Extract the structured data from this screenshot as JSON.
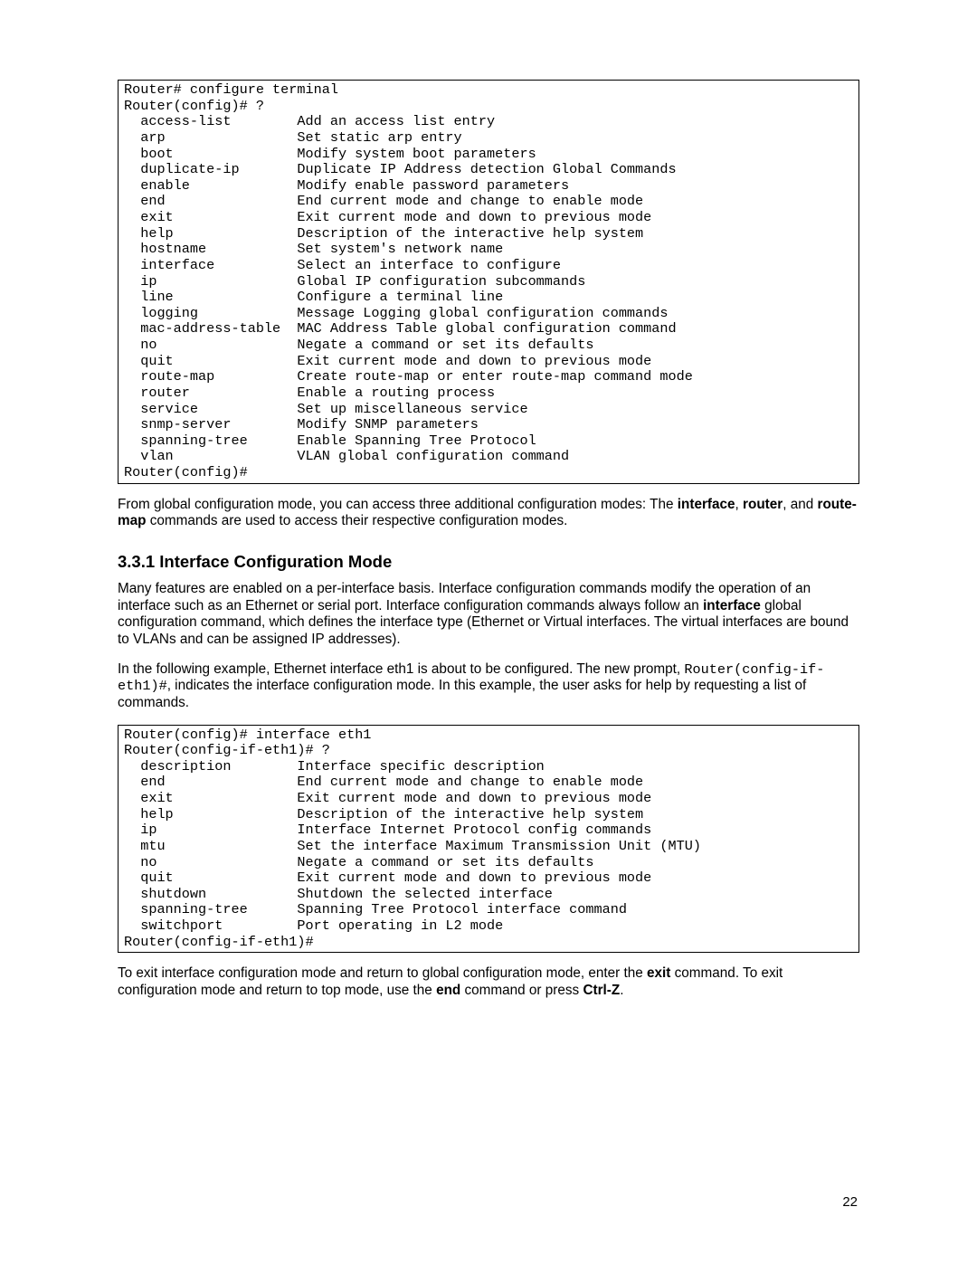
{
  "cli1": {
    "lines_top": [
      "Router# configure terminal",
      "Router(config)# ?"
    ],
    "items": [
      {
        "cmd": "access-list",
        "desc": "Add an access list entry"
      },
      {
        "cmd": "arp",
        "desc": "Set static arp entry"
      },
      {
        "cmd": "boot",
        "desc": "Modify system boot parameters"
      },
      {
        "cmd": "duplicate-ip",
        "desc": "Duplicate IP Address detection Global Commands"
      },
      {
        "cmd": "enable",
        "desc": "Modify enable password parameters"
      },
      {
        "cmd": "end",
        "desc": "End current mode and change to enable mode"
      },
      {
        "cmd": "exit",
        "desc": "Exit current mode and down to previous mode"
      },
      {
        "cmd": "help",
        "desc": "Description of the interactive help system"
      },
      {
        "cmd": "hostname",
        "desc": "Set system's network name"
      },
      {
        "cmd": "interface",
        "desc": "Select an interface to configure"
      },
      {
        "cmd": "ip",
        "desc": "Global IP configuration subcommands"
      },
      {
        "cmd": "line",
        "desc": "Configure a terminal line"
      },
      {
        "cmd": "logging",
        "desc": "Message Logging global configuration commands"
      },
      {
        "cmd": "mac-address-table",
        "desc": "MAC Address Table global configuration command"
      },
      {
        "cmd": "no",
        "desc": "Negate a command or set its defaults"
      },
      {
        "cmd": "quit",
        "desc": "Exit current mode and down to previous mode"
      },
      {
        "cmd": "route-map",
        "desc": "Create route-map or enter route-map command mode"
      },
      {
        "cmd": "router",
        "desc": "Enable a routing process"
      },
      {
        "cmd": "service",
        "desc": "Set up miscellaneous service"
      },
      {
        "cmd": "snmp-server",
        "desc": "Modify SNMP parameters"
      },
      {
        "cmd": "spanning-tree",
        "desc": "Enable Spanning Tree Protocol"
      },
      {
        "cmd": "vlan",
        "desc": "VLAN global configuration command"
      }
    ],
    "lines_bottom": [
      "Router(config)#"
    ]
  },
  "para1": {
    "pre1": "From global configuration mode, you can access three additional configuration modes: The ",
    "b1": "interface",
    "mid1": ", ",
    "b2": "router",
    "mid2": ", and ",
    "b3": "route-map",
    "post": " commands are used to access their respective configuration modes."
  },
  "h3": "3.3.1 Interface Configuration Mode",
  "para2": {
    "l1a": "Many features are enabled on a per-interface basis. Interface configuration commands modify the operation ",
    "l1b": "of an interface such as an Ethernet or serial port. Interface configuration commands always follow an ",
    "b1": "interface",
    "l1c": " global configuration command, which defines the interface type (Ethernet or Virtual interfaces. The ",
    "l1d": "virtual interfaces are bound to VLANs and can be assigned IP addresses)."
  },
  "para3": {
    "l1": "In the following example, Ethernet interface eth1 is about to be configured. The new prompt, ",
    "mono": "Router(config-if-eth1)#",
    "l2": ", indicates the interface configuration mode. In this example, the user asks ",
    "l3": "for help by requesting a list of commands."
  },
  "cli2": {
    "lines_top": [
      "Router(config)# interface eth1",
      "Router(config-if-eth1)# ?"
    ],
    "items": [
      {
        "cmd": "description",
        "desc": "Interface specific description"
      },
      {
        "cmd": "end",
        "desc": "End current mode and change to enable mode"
      },
      {
        "cmd": "exit",
        "desc": "Exit current mode and down to previous mode"
      },
      {
        "cmd": "help",
        "desc": "Description of the interactive help system"
      },
      {
        "cmd": "ip",
        "desc": "Interface Internet Protocol config commands"
      },
      {
        "cmd": "mtu",
        "desc": "Set the interface Maximum Transmission Unit (MTU)"
      },
      {
        "cmd": "no",
        "desc": "Negate a command or set its defaults"
      },
      {
        "cmd": "quit",
        "desc": "Exit current mode and down to previous mode"
      },
      {
        "cmd": "shutdown",
        "desc": "Shutdown the selected interface"
      },
      {
        "cmd": "spanning-tree",
        "desc": "Spanning Tree Protocol interface command"
      },
      {
        "cmd": "switchport",
        "desc": "Port operating in L2 mode"
      }
    ],
    "lines_bottom": [
      "Router(config-if-eth1)#"
    ]
  },
  "para4": {
    "pre": "To exit interface configuration mode and return to global configuration mode, enter the ",
    "b1": "exit",
    "mid": " command. To exit configuration mode and return to top mode, use the ",
    "b2": "end",
    "mid2": " command or press ",
    "b3": "Ctrl-Z",
    "post": "."
  },
  "page_number": "22"
}
